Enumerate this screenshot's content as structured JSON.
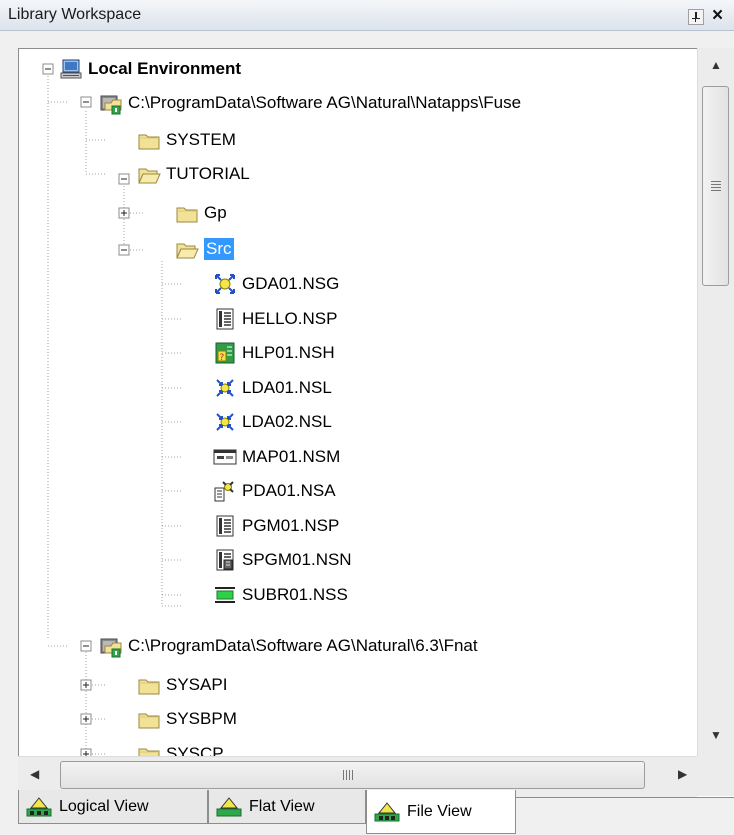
{
  "window": {
    "title": "Library Workspace"
  },
  "tree": {
    "root": {
      "label": "Local Environment",
      "icon": "computer-icon"
    },
    "lib1": {
      "label": "C:\\ProgramData\\Software AG\\Natural\\Natapps\\Fuse",
      "icon": "library-drive-icon"
    },
    "system": {
      "label": "SYSTEM",
      "icon": "folder-closed-icon"
    },
    "tutorial": {
      "label": "TUTORIAL",
      "icon": "folder-open-icon"
    },
    "gp": {
      "label": "Gp",
      "icon": "folder-closed-icon"
    },
    "src": {
      "label": "Src",
      "icon": "folder-open-icon",
      "selected": true
    },
    "files": [
      {
        "label": "GDA01.NSG",
        "icon": "global-data-area-icon"
      },
      {
        "label": "HELLO.NSP",
        "icon": "program-icon"
      },
      {
        "label": "HLP01.NSH",
        "icon": "helproutine-icon"
      },
      {
        "label": "LDA01.NSL",
        "icon": "local-data-area-icon"
      },
      {
        "label": "LDA02.NSL",
        "icon": "local-data-area-icon"
      },
      {
        "label": "MAP01.NSM",
        "icon": "map-icon"
      },
      {
        "label": "PDA01.NSA",
        "icon": "parameter-data-area-icon"
      },
      {
        "label": "PGM01.NSP",
        "icon": "program-icon"
      },
      {
        "label": "SPGM01.NSN",
        "icon": "subprogram-icon"
      },
      {
        "label": "SUBR01.NSS",
        "icon": "subroutine-icon"
      }
    ],
    "lib2": {
      "label": "C:\\ProgramData\\Software AG\\Natural\\6.3\\Fnat",
      "icon": "library-drive-icon"
    },
    "sysapi": {
      "label": "SYSAPI",
      "icon": "folder-closed-icon"
    },
    "sysbpm": {
      "label": "SYSBPM",
      "icon": "folder-closed-icon"
    },
    "syscp": {
      "label": "SYSCP",
      "icon": "folder-closed-icon"
    }
  },
  "scrollbar": {
    "h_grip": "III"
  },
  "tabs": [
    {
      "label": "Logical View",
      "icon": "logical-view-icon",
      "active": false
    },
    {
      "label": "Flat View",
      "icon": "flat-view-icon",
      "active": false
    },
    {
      "label": "File View",
      "icon": "file-view-icon",
      "active": true
    }
  ],
  "colors": {
    "selection": "#3399ff",
    "folder": "#f2e295",
    "tree_line": "#a0a0a0"
  }
}
